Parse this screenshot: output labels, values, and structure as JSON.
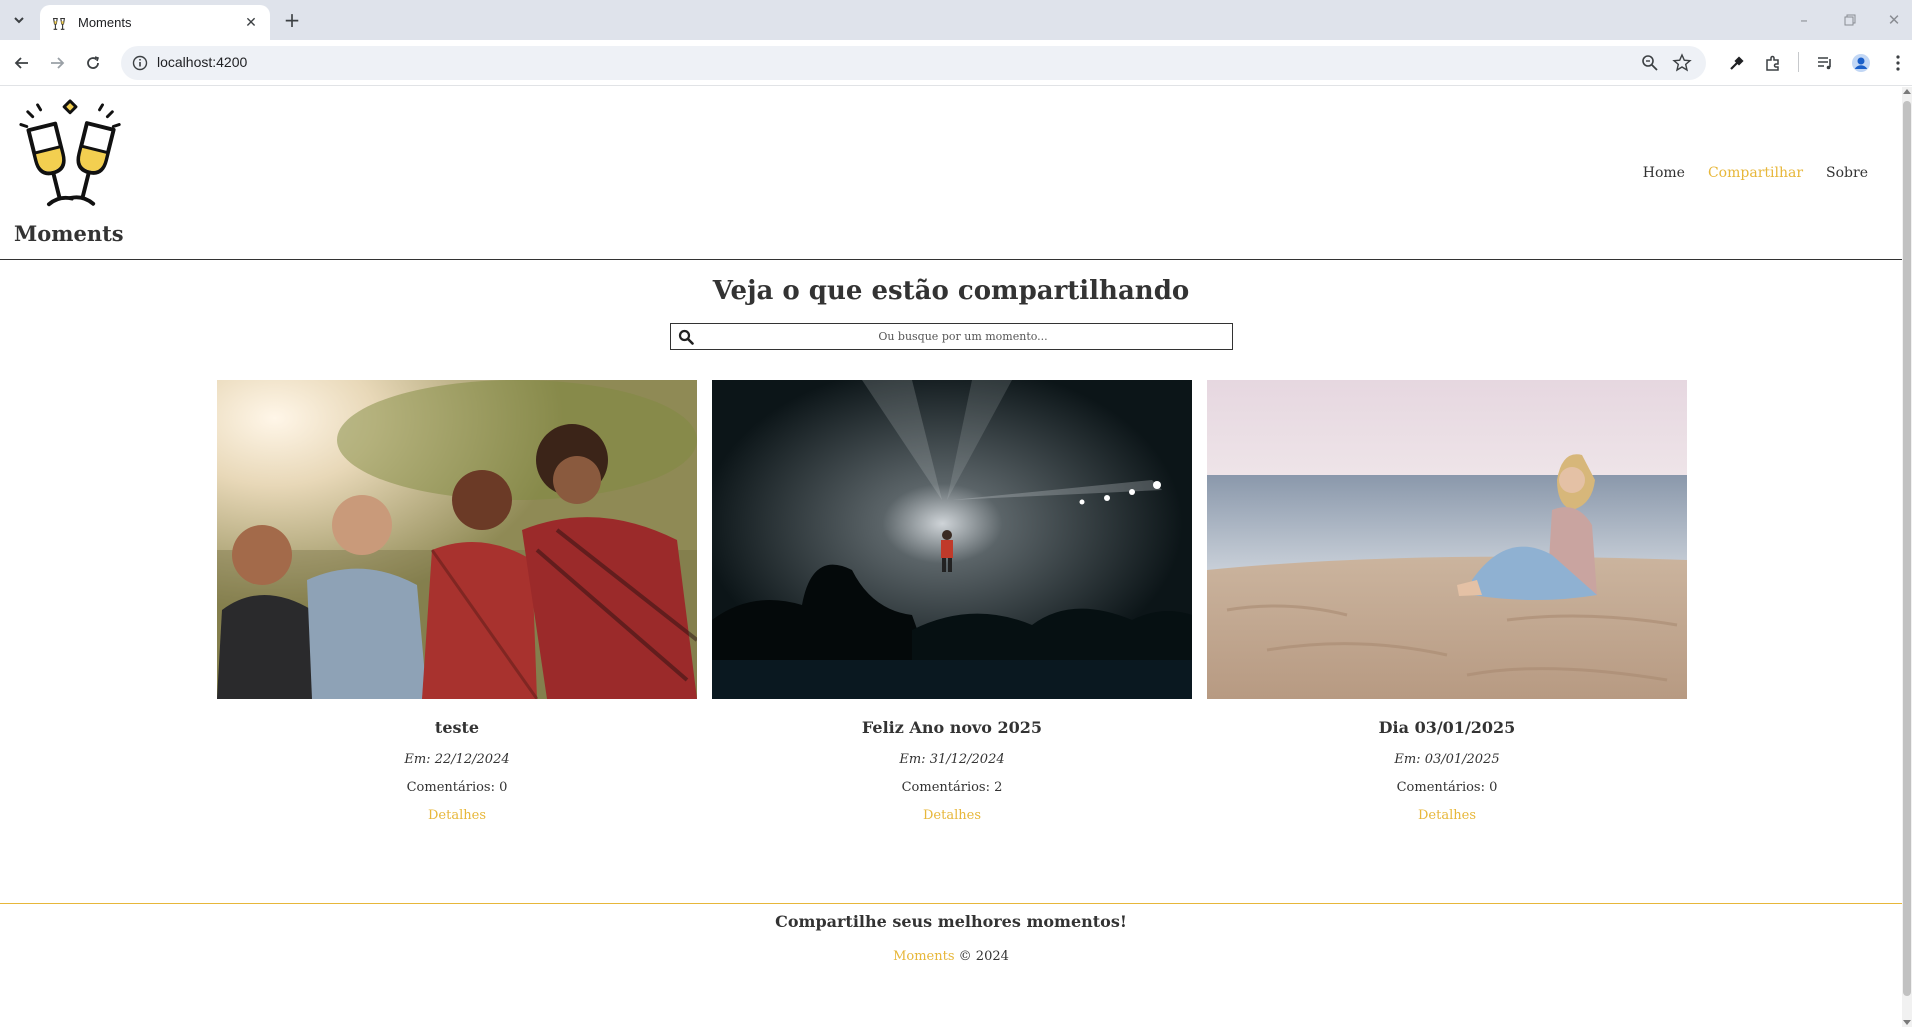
{
  "browser": {
    "tab_title": "Moments",
    "url": "localhost:4200",
    "icons": [
      "tab-search-icon",
      "close-icon",
      "new-tab-icon",
      "minimize-icon",
      "restore-icon",
      "close-window-icon",
      "back-icon",
      "forward-icon",
      "reload-icon",
      "site-info-icon",
      "zoom-icon",
      "bookmark-star-icon",
      "eyedropper-icon",
      "extensions-icon",
      "media-controls-icon",
      "profile-icon",
      "more-menu-icon"
    ]
  },
  "navbar": {
    "brand": "Moments",
    "links": [
      {
        "label": "Home",
        "active": false
      },
      {
        "label": "Compartilhar",
        "active": true
      },
      {
        "label": "Sobre",
        "active": false
      }
    ]
  },
  "main": {
    "heading": "Veja o que estão compartilhando",
    "search_placeholder": "Ou busque por um momento..."
  },
  "moments": [
    {
      "title": "teste",
      "date": "Em: 22/12/2024",
      "comments": "Comentários: 0",
      "details": "Detalhes",
      "image": "friends-photo"
    },
    {
      "title": "Feliz Ano novo 2025",
      "date": "Em: 31/12/2024",
      "comments": "Comentários: 2",
      "details": "Detalhes",
      "image": "concert-photo"
    },
    {
      "title": "Dia 03/01/2025",
      "date": "Em: 03/01/2025",
      "comments": "Comentários: 0",
      "details": "Detalhes",
      "image": "beach-photo"
    }
  ],
  "footer": {
    "tagline": "Compartilhe seus melhores momentos!",
    "brand": "Moments",
    "copyright": " © 2024"
  },
  "colors": {
    "accent": "#e7b73a",
    "text": "#333333",
    "chrome_bg": "#dfe3eb"
  }
}
